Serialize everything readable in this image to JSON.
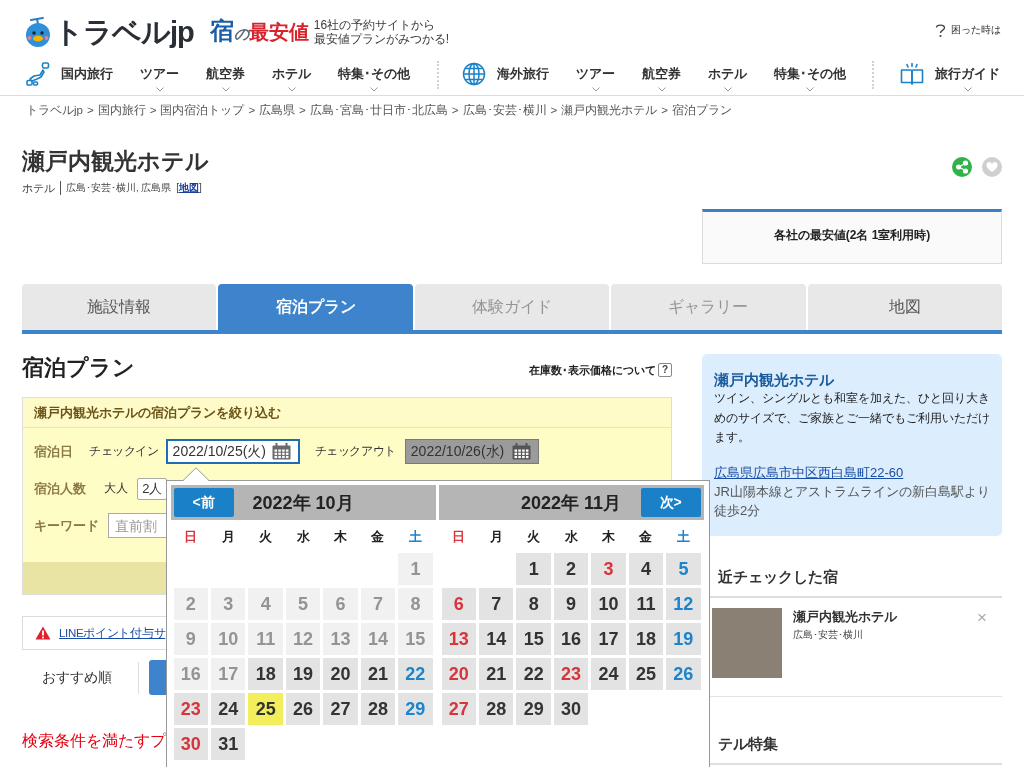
{
  "header": {
    "logo": "トラベルjp",
    "sub_logo": [
      "宿",
      "の",
      "最安値"
    ],
    "tagline": [
      "16社の予約サイトから",
      "最安値プランがみつかる!"
    ],
    "help": "困った時は"
  },
  "nav_groups": [
    {
      "items": [
        {
          "label": "国内旅行",
          "has_menu": false
        },
        {
          "label": "ツアー",
          "has_menu": true
        },
        {
          "label": "航空券",
          "has_menu": true
        },
        {
          "label": "ホテル",
          "has_menu": true
        },
        {
          "label": "特集･その他",
          "has_menu": true
        }
      ]
    },
    {
      "items": [
        {
          "label": "海外旅行",
          "has_menu": false
        },
        {
          "label": "ツアー",
          "has_menu": true
        },
        {
          "label": "航空券",
          "has_menu": true
        },
        {
          "label": "ホテル",
          "has_menu": true
        },
        {
          "label": "特集･その他",
          "has_menu": true
        }
      ]
    },
    {
      "items": [
        {
          "label": "旅行ガイド",
          "has_menu": true
        }
      ]
    }
  ],
  "breadcrumb": [
    {
      "label": "トラベルjp",
      "separator": ">"
    },
    {
      "label": "国内旅行",
      "separator": ">"
    },
    {
      "label": "国内宿泊トップ",
      "separator": ">"
    },
    {
      "label": "広島県",
      "separator": ">"
    },
    {
      "label": "広島･宮島･廿日市･北広島",
      "separator": ">"
    },
    {
      "label": "広島･安芸･横川",
      "separator": ">"
    },
    {
      "label": "瀬戸内観光ホテル",
      "separator": ">"
    },
    {
      "label": "宿泊プラン"
    }
  ],
  "hotel": {
    "name": "瀬戸内観光ホテル",
    "type": "ホテル",
    "area": "広島･安芸･横川, 広島県",
    "map_link": {
      "open": "[",
      "label": "地図",
      "close": "]"
    },
    "favorite": false
  },
  "best_price": {
    "title": "各社の最安値(2名 1室利用時)"
  },
  "tabs": [
    {
      "label": "施設情報",
      "selected": false,
      "disabled": false
    },
    {
      "label": "宿泊プラン",
      "selected": true,
      "disabled": false
    },
    {
      "label": "体験ガイド",
      "selected": false,
      "disabled": true
    },
    {
      "label": "ギャラリー",
      "selected": false,
      "disabled": true
    },
    {
      "label": "地図",
      "selected": false,
      "disabled": false
    }
  ],
  "plans": {
    "title": "宿泊プラン",
    "info_link": "在庫数･表示価格について",
    "help_mark": "?"
  },
  "filter": {
    "title": "瀬戸内観光ホテルの宿泊プランを絞り込む",
    "stay_label": "宿泊日",
    "date_fields": [
      {
        "label": "チェックイン",
        "value": "2022/10/25(火)",
        "active": true
      },
      {
        "label": "チェックアウト",
        "value": "2022/10/26(水)",
        "active": false
      }
    ],
    "guests_label": "宿泊人数",
    "adults_label": "大人",
    "adults": "2人",
    "keyword_label": "キーワード",
    "keyword_placeholder": "直前割"
  },
  "notice": {
    "text": "LINEポイント付与サ"
  },
  "sort": [
    {
      "label": "おすすめ順",
      "selected": false
    },
    {
      "selected": true
    }
  ],
  "result_message": "検索条件を満たすプ",
  "calendar": {
    "months": [
      {
        "title": "2022年 10月",
        "nav": {
          "kind": "prev",
          "label": "<前"
        },
        "weekdays": [
          {
            "label": "日",
            "kind": "sunday"
          },
          {
            "label": "月",
            "kind": "weekday"
          },
          {
            "label": "火",
            "kind": "weekday"
          },
          {
            "label": "水",
            "kind": "weekday"
          },
          {
            "label": "木",
            "kind": "weekday"
          },
          {
            "label": "金",
            "kind": "weekday"
          },
          {
            "label": "土",
            "kind": "saturday"
          }
        ],
        "days": [
          {
            "kind": "blank"
          },
          {
            "kind": "blank"
          },
          {
            "kind": "blank"
          },
          {
            "kind": "blank"
          },
          {
            "kind": "blank"
          },
          {
            "kind": "blank"
          },
          {
            "day": "1",
            "disabled": true,
            "selected": false
          },
          {
            "day": "2",
            "disabled": true,
            "selected": false
          },
          {
            "day": "3",
            "disabled": true,
            "selected": false
          },
          {
            "day": "4",
            "disabled": true,
            "selected": false
          },
          {
            "day": "5",
            "disabled": true,
            "selected": false
          },
          {
            "day": "6",
            "disabled": true,
            "selected": false
          },
          {
            "day": "7",
            "disabled": true,
            "selected": false
          },
          {
            "day": "8",
            "disabled": true,
            "selected": false
          },
          {
            "day": "9",
            "disabled": true,
            "selected": false
          },
          {
            "day": "10",
            "disabled": true,
            "selected": false
          },
          {
            "day": "11",
            "disabled": true,
            "selected": false
          },
          {
            "day": "12",
            "disabled": true,
            "selected": false
          },
          {
            "day": "13",
            "disabled": true,
            "selected": false
          },
          {
            "day": "14",
            "disabled": true,
            "selected": false
          },
          {
            "day": "15",
            "disabled": true,
            "selected": false
          },
          {
            "day": "16",
            "disabled": true,
            "selected": false
          },
          {
            "day": "17",
            "disabled": true,
            "selected": false
          },
          {
            "day": "18",
            "kind": "weekday",
            "disabled": false,
            "selected": false
          },
          {
            "day": "19",
            "kind": "weekday",
            "disabled": false,
            "selected": false
          },
          {
            "day": "20",
            "kind": "weekday",
            "disabled": false,
            "selected": false
          },
          {
            "day": "21",
            "kind": "weekday",
            "disabled": false,
            "selected": false
          },
          {
            "day": "22",
            "kind": "saturday",
            "disabled": false,
            "selected": false
          },
          {
            "day": "23",
            "kind": "sunday",
            "disabled": false,
            "selected": false
          },
          {
            "day": "24",
            "kind": "weekday",
            "disabled": false,
            "selected": false
          },
          {
            "day": "25",
            "kind": "weekday",
            "disabled": false,
            "selected": true
          },
          {
            "day": "26",
            "kind": "weekday",
            "disabled": false,
            "selected": false
          },
          {
            "day": "27",
            "kind": "weekday",
            "disabled": false,
            "selected": false
          },
          {
            "day": "28",
            "kind": "weekday",
            "disabled": false,
            "selected": false
          },
          {
            "day": "29",
            "kind": "saturday",
            "disabled": false,
            "selected": false
          },
          {
            "day": "30",
            "kind": "sunday",
            "disabled": false,
            "selected": false
          },
          {
            "day": "31",
            "kind": "weekday",
            "disabled": false,
            "selected": false
          }
        ]
      },
      {
        "title": "2022年 11月",
        "nav": {
          "kind": "next",
          "label": "次>"
        },
        "weekdays": [
          {
            "label": "日",
            "kind": "sunday"
          },
          {
            "label": "月",
            "kind": "weekday"
          },
          {
            "label": "火",
            "kind": "weekday"
          },
          {
            "label": "水",
            "kind": "weekday"
          },
          {
            "label": "木",
            "kind": "weekday"
          },
          {
            "label": "金",
            "kind": "weekday"
          },
          {
            "label": "土",
            "kind": "saturday"
          }
        ],
        "days": [
          {
            "kind": "blank"
          },
          {
            "kind": "blank"
          },
          {
            "day": "1",
            "kind": "weekday",
            "disabled": false,
            "selected": false
          },
          {
            "day": "2",
            "kind": "weekday",
            "disabled": false,
            "selected": false
          },
          {
            "day": "3",
            "kind": "holiday",
            "disabled": false,
            "selected": false
          },
          {
            "day": "4",
            "kind": "weekday",
            "disabled": false,
            "selected": false
          },
          {
            "day": "5",
            "kind": "saturday",
            "disabled": false,
            "selected": false
          },
          {
            "day": "6",
            "kind": "sunday",
            "disabled": false,
            "selected": false
          },
          {
            "day": "7",
            "kind": "weekday",
            "disabled": false,
            "selected": false
          },
          {
            "day": "8",
            "kind": "weekday",
            "disabled": false,
            "selected": false
          },
          {
            "day": "9",
            "kind": "weekday",
            "disabled": false,
            "selected": false
          },
          {
            "day": "10",
            "kind": "weekday",
            "disabled": false,
            "selected": false
          },
          {
            "day": "11",
            "kind": "weekday",
            "disabled": false,
            "selected": false
          },
          {
            "day": "12",
            "kind": "saturday",
            "disabled": false,
            "selected": false
          },
          {
            "day": "13",
            "kind": "sunday",
            "disabled": false,
            "selected": false
          },
          {
            "day": "14",
            "kind": "weekday",
            "disabled": false,
            "selected": false
          },
          {
            "day": "15",
            "kind": "weekday",
            "disabled": false,
            "selected": false
          },
          {
            "day": "16",
            "kind": "weekday",
            "disabled": false,
            "selected": false
          },
          {
            "day": "17",
            "kind": "weekday",
            "disabled": false,
            "selected": false
          },
          {
            "day": "18",
            "kind": "weekday",
            "disabled": false,
            "selected": false
          },
          {
            "day": "19",
            "kind": "saturday",
            "disabled": false,
            "selected": false
          },
          {
            "day": "20",
            "kind": "sunday",
            "disabled": false,
            "selected": false
          },
          {
            "day": "21",
            "kind": "weekday",
            "disabled": false,
            "selected": false
          },
          {
            "day": "22",
            "kind": "weekday",
            "disabled": false,
            "selected": false
          },
          {
            "day": "23",
            "kind": "holiday",
            "disabled": false,
            "selected": false
          },
          {
            "day": "24",
            "kind": "weekday",
            "disabled": false,
            "selected": false
          },
          {
            "day": "25",
            "kind": "weekday",
            "disabled": false,
            "selected": false
          },
          {
            "day": "26",
            "kind": "saturday",
            "disabled": false,
            "selected": false
          },
          {
            "day": "27",
            "kind": "sunday",
            "disabled": false,
            "selected": false
          },
          {
            "day": "28",
            "kind": "weekday",
            "disabled": false,
            "selected": false
          },
          {
            "day": "29",
            "kind": "weekday",
            "disabled": false,
            "selected": false
          },
          {
            "day": "30",
            "kind": "weekday",
            "disabled": false,
            "selected": false
          }
        ]
      }
    ]
  },
  "hotel_info": {
    "name": "瀬戸内観光ホテル",
    "description": "ツイン、シングルとも和室を加えた、ひと回り大きめのサイズで、ご家族とご一緒でもご利用いただけます。",
    "address": "広島県広島市中区西白島町22-60",
    "access": "JR山陽本線とアストラムラインの新白島駅より徒歩2分"
  },
  "recent": {
    "title": "近チェックした宿",
    "items": [
      {
        "name": "瀬戸内観光ホテル",
        "area": "広島･安芸･横川",
        "close": "×"
      }
    ]
  },
  "feature": {
    "title": "テル特集"
  }
}
